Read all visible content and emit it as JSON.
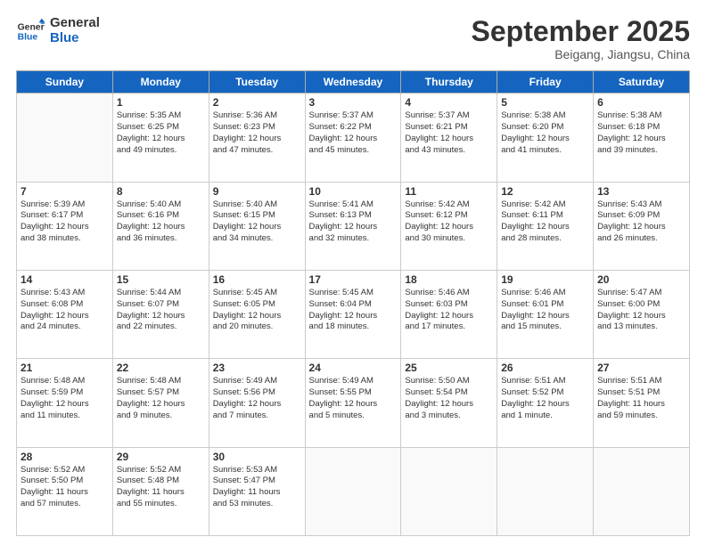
{
  "header": {
    "logo_general": "General",
    "logo_blue": "Blue",
    "month": "September 2025",
    "location": "Beigang, Jiangsu, China"
  },
  "weekdays": [
    "Sunday",
    "Monday",
    "Tuesday",
    "Wednesday",
    "Thursday",
    "Friday",
    "Saturday"
  ],
  "weeks": [
    [
      {
        "day": "",
        "content": ""
      },
      {
        "day": "1",
        "content": "Sunrise: 5:35 AM\nSunset: 6:25 PM\nDaylight: 12 hours\nand 49 minutes."
      },
      {
        "day": "2",
        "content": "Sunrise: 5:36 AM\nSunset: 6:23 PM\nDaylight: 12 hours\nand 47 minutes."
      },
      {
        "day": "3",
        "content": "Sunrise: 5:37 AM\nSunset: 6:22 PM\nDaylight: 12 hours\nand 45 minutes."
      },
      {
        "day": "4",
        "content": "Sunrise: 5:37 AM\nSunset: 6:21 PM\nDaylight: 12 hours\nand 43 minutes."
      },
      {
        "day": "5",
        "content": "Sunrise: 5:38 AM\nSunset: 6:20 PM\nDaylight: 12 hours\nand 41 minutes."
      },
      {
        "day": "6",
        "content": "Sunrise: 5:38 AM\nSunset: 6:18 PM\nDaylight: 12 hours\nand 39 minutes."
      }
    ],
    [
      {
        "day": "7",
        "content": "Sunrise: 5:39 AM\nSunset: 6:17 PM\nDaylight: 12 hours\nand 38 minutes."
      },
      {
        "day": "8",
        "content": "Sunrise: 5:40 AM\nSunset: 6:16 PM\nDaylight: 12 hours\nand 36 minutes."
      },
      {
        "day": "9",
        "content": "Sunrise: 5:40 AM\nSunset: 6:15 PM\nDaylight: 12 hours\nand 34 minutes."
      },
      {
        "day": "10",
        "content": "Sunrise: 5:41 AM\nSunset: 6:13 PM\nDaylight: 12 hours\nand 32 minutes."
      },
      {
        "day": "11",
        "content": "Sunrise: 5:42 AM\nSunset: 6:12 PM\nDaylight: 12 hours\nand 30 minutes."
      },
      {
        "day": "12",
        "content": "Sunrise: 5:42 AM\nSunset: 6:11 PM\nDaylight: 12 hours\nand 28 minutes."
      },
      {
        "day": "13",
        "content": "Sunrise: 5:43 AM\nSunset: 6:09 PM\nDaylight: 12 hours\nand 26 minutes."
      }
    ],
    [
      {
        "day": "14",
        "content": "Sunrise: 5:43 AM\nSunset: 6:08 PM\nDaylight: 12 hours\nand 24 minutes."
      },
      {
        "day": "15",
        "content": "Sunrise: 5:44 AM\nSunset: 6:07 PM\nDaylight: 12 hours\nand 22 minutes."
      },
      {
        "day": "16",
        "content": "Sunrise: 5:45 AM\nSunset: 6:05 PM\nDaylight: 12 hours\nand 20 minutes."
      },
      {
        "day": "17",
        "content": "Sunrise: 5:45 AM\nSunset: 6:04 PM\nDaylight: 12 hours\nand 18 minutes."
      },
      {
        "day": "18",
        "content": "Sunrise: 5:46 AM\nSunset: 6:03 PM\nDaylight: 12 hours\nand 17 minutes."
      },
      {
        "day": "19",
        "content": "Sunrise: 5:46 AM\nSunset: 6:01 PM\nDaylight: 12 hours\nand 15 minutes."
      },
      {
        "day": "20",
        "content": "Sunrise: 5:47 AM\nSunset: 6:00 PM\nDaylight: 12 hours\nand 13 minutes."
      }
    ],
    [
      {
        "day": "21",
        "content": "Sunrise: 5:48 AM\nSunset: 5:59 PM\nDaylight: 12 hours\nand 11 minutes."
      },
      {
        "day": "22",
        "content": "Sunrise: 5:48 AM\nSunset: 5:57 PM\nDaylight: 12 hours\nand 9 minutes."
      },
      {
        "day": "23",
        "content": "Sunrise: 5:49 AM\nSunset: 5:56 PM\nDaylight: 12 hours\nand 7 minutes."
      },
      {
        "day": "24",
        "content": "Sunrise: 5:49 AM\nSunset: 5:55 PM\nDaylight: 12 hours\nand 5 minutes."
      },
      {
        "day": "25",
        "content": "Sunrise: 5:50 AM\nSunset: 5:54 PM\nDaylight: 12 hours\nand 3 minutes."
      },
      {
        "day": "26",
        "content": "Sunrise: 5:51 AM\nSunset: 5:52 PM\nDaylight: 12 hours\nand 1 minute."
      },
      {
        "day": "27",
        "content": "Sunrise: 5:51 AM\nSunset: 5:51 PM\nDaylight: 11 hours\nand 59 minutes."
      }
    ],
    [
      {
        "day": "28",
        "content": "Sunrise: 5:52 AM\nSunset: 5:50 PM\nDaylight: 11 hours\nand 57 minutes."
      },
      {
        "day": "29",
        "content": "Sunrise: 5:52 AM\nSunset: 5:48 PM\nDaylight: 11 hours\nand 55 minutes."
      },
      {
        "day": "30",
        "content": "Sunrise: 5:53 AM\nSunset: 5:47 PM\nDaylight: 11 hours\nand 53 minutes."
      },
      {
        "day": "",
        "content": ""
      },
      {
        "day": "",
        "content": ""
      },
      {
        "day": "",
        "content": ""
      },
      {
        "day": "",
        "content": ""
      }
    ]
  ]
}
